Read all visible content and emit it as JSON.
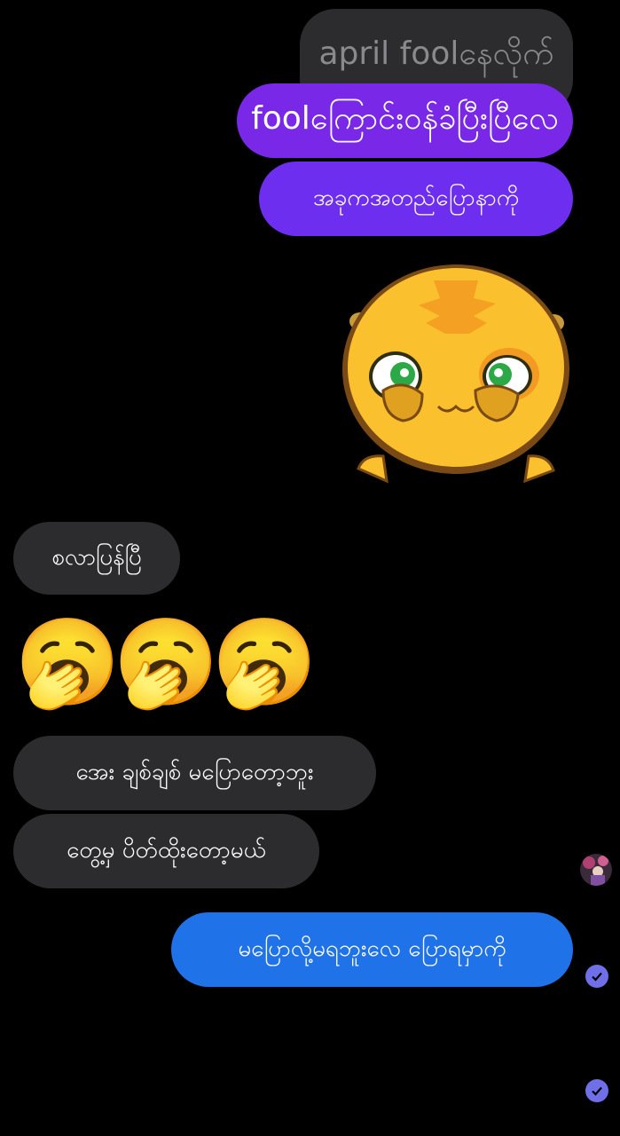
{
  "messages": {
    "m1": "april foolနေလိုက်",
    "m2": "foolကြောင်းဝန်ခံပြီးပြီလေ",
    "m3": "အခုကအတည်ပြောနာကို",
    "m4": "စလာပြန်ပြီ",
    "m5": "အေး ချစ်ချစ် မပြောတော့ဘူး",
    "m6": "တွေ့မှ ပိတ်ထိုးတော့မယ်",
    "m7": "မပြောလို့မရဘူးလေ ပြောရမှာကို"
  },
  "emojis": {
    "yawn": "🥱",
    "pensive": "😔"
  },
  "icons": {
    "sticker": "yellow-cat-sticker",
    "read_receipt": "check-circle-icon",
    "avatar": "contact-avatar"
  },
  "colors": {
    "background": "#000000",
    "received_bubble": "#2c2c2e",
    "sent_purple": "#7a28e8",
    "sent_blue": "#1f72e8",
    "read_receipt": "#6f6fe8"
  }
}
